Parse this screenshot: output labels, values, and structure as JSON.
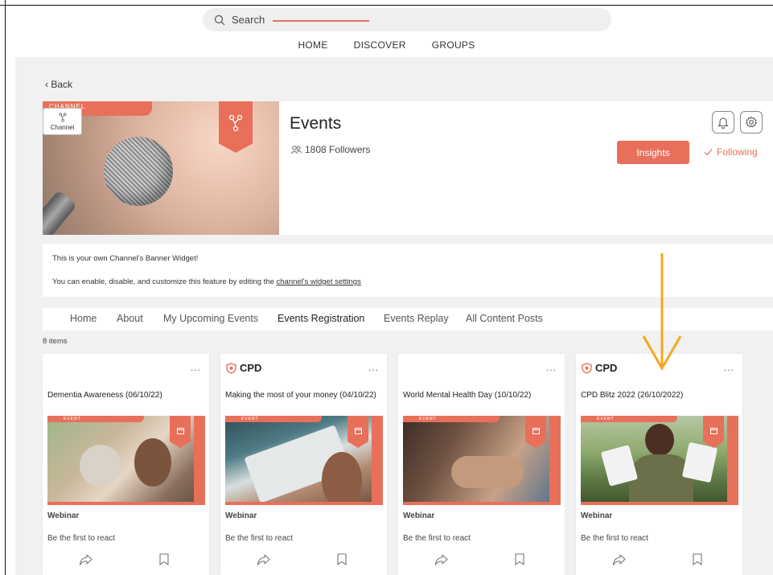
{
  "header": {
    "search_placeholder": "Search",
    "nav": [
      "HOME",
      "DISCOVER",
      "GROUPS"
    ]
  },
  "back_label": "‹ Back",
  "channel": {
    "type_label": "Channel",
    "banner_tag": "CHANNEL",
    "title": "Events",
    "followers": "1808 Followers",
    "insights_label": "Insights",
    "following_label": "Following"
  },
  "widget": {
    "line1": "This is your own Channel's Banner Widget!",
    "line2_prefix": "You can enable, disable, and customize this feature by editing the ",
    "line2_link": "channel's widget settings"
  },
  "tabs": [
    {
      "label": "Home",
      "active": false
    },
    {
      "label": "About",
      "active": false
    },
    {
      "label": "My Upcoming Events",
      "active": false
    },
    {
      "label": "Events Registration",
      "active": true
    },
    {
      "label": "Events Replay",
      "active": false
    },
    {
      "label": "All Content Posts",
      "active": false
    }
  ],
  "items_count": "8 items",
  "cards": [
    {
      "badge": "",
      "title": "Dementia Awareness (06/10/22)",
      "type": "Webinar",
      "reaction": "Be the first to react",
      "img_tag": "EVENT"
    },
    {
      "badge": "CPD",
      "title": "Making the most of your money (04/10/22)",
      "type": "Webinar",
      "reaction": "Be the first to react",
      "img_tag": "EVENT"
    },
    {
      "badge": "",
      "title": "World Mental Health Day (10/10/22)",
      "type": "Webinar",
      "reaction": "Be the first to react",
      "img_tag": "EVENT"
    },
    {
      "badge": "CPD",
      "title": "CPD Blitz 2022 (26/10/2022)",
      "type": "Webinar",
      "reaction": "Be the first to react",
      "img_tag": "EVENT"
    }
  ],
  "more_label": "...",
  "colors": {
    "accent": "#e8705a",
    "annotation_arrow": "#f2a81d",
    "background": "#f1f1f1"
  },
  "icons": [
    "search-icon",
    "channel-icon",
    "followers-icon",
    "bell-icon",
    "gear-icon",
    "check-icon",
    "cpd-shield-icon",
    "calendar-icon",
    "share-icon",
    "bookmark-icon"
  ]
}
